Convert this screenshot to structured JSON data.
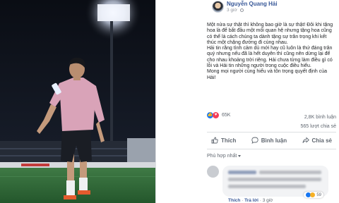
{
  "post": {
    "author": "Nguyễn Quang Hải",
    "time": "3 giờ",
    "body": [
      "Một nửa sự thật thì không bao giờ là sự thật! Đôi khi tặng hoa là để bắt đầu một mối quan hệ nhưng tặng hoa cũng có thể là cách chúng ta dành tặng sự trân trọng khi kết thúc một chặng đường đi cùng nhau.",
      "Hải tin rằng tình cảm dù mới hay cũ luôn là thứ đáng trân quý nhưng nếu đã là hết duyên thì cũng nên dừng lại để cho nhau khoảng trời riêng. Hải chưa từng làm điều gì có lỗi và Hải tin những người trong cuộc điều hiểu.",
      "Mong mọi người cùng hiểu và tôn trọng quyết định của Hải!"
    ],
    "reaction_count": "65K",
    "comments_count": "2,8K bình luận",
    "shares_count": "565 lượt chia sẻ"
  },
  "actions": {
    "like": "Thích",
    "comment": "Bình luận",
    "share": "Chia sẻ"
  },
  "comment_filter": "Phù hợp nhất",
  "comment": {
    "react_count": "59",
    "like_link": "Thích",
    "reply_link": "Trả lời",
    "time": "3 giờ"
  },
  "icons": {
    "globe": "globe-icon",
    "like": "thumbs-up-icon",
    "comment": "speech-bubble-icon",
    "share": "share-arrow-icon"
  },
  "colors": {
    "link_blue": "#385898",
    "like_blue": "#1877f2",
    "love_red": "#f33e58",
    "muted": "#606770",
    "pitch_green": "#2f6a3a"
  }
}
